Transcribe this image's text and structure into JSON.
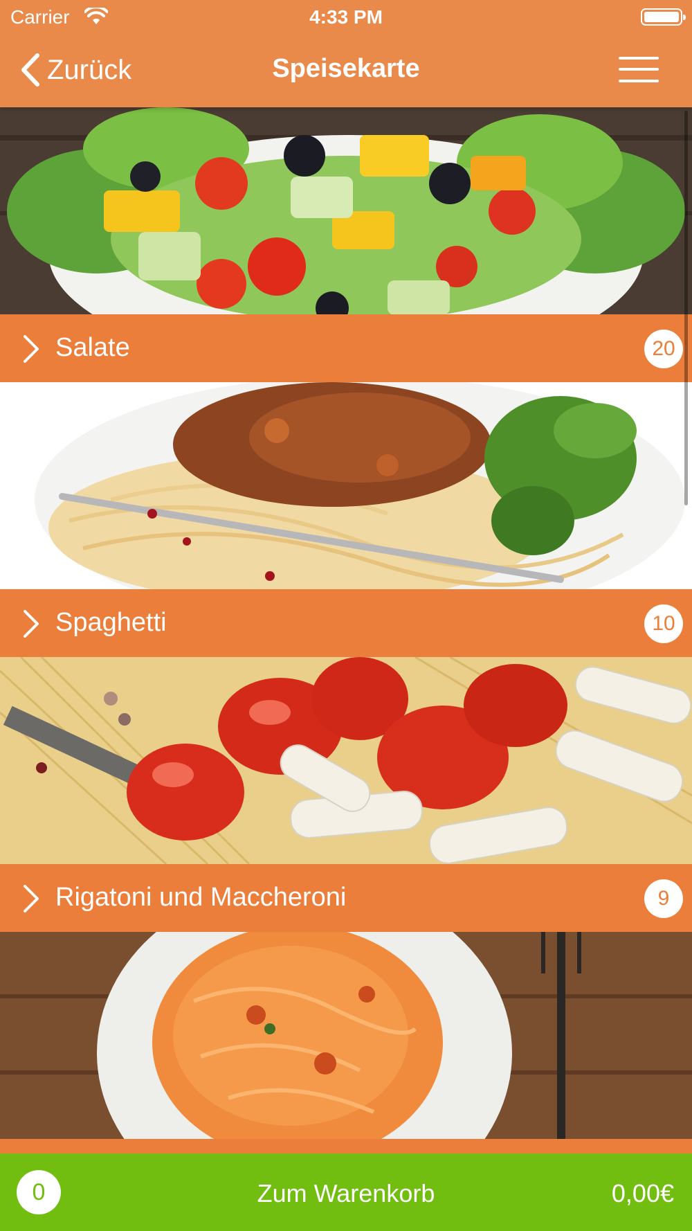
{
  "status_bar": {
    "carrier": "Carrier",
    "time": "4:33 PM"
  },
  "nav": {
    "back_label": "Zurück",
    "title": "Speisekarte",
    "icons": {
      "back": "chevron-left-icon",
      "menu": "hamburger-menu-icon"
    }
  },
  "categories": [
    {
      "name": "Salate",
      "count": "20",
      "image": "salad-photo"
    },
    {
      "name": "Spaghetti",
      "count": "10",
      "image": "spaghetti-bolognese-photo"
    },
    {
      "name": "Rigatoni und Maccheroni",
      "count": "9",
      "image": "rigatoni-tomatoes-photo"
    },
    {
      "name": "",
      "count": "",
      "image": "tagliatelle-photo"
    }
  ],
  "cart": {
    "count": "0",
    "label": "Zum Warenkorb",
    "total": "0,00€"
  },
  "colors": {
    "header": "#E9894A",
    "category_bar": "#EB7E3A",
    "cart_bar": "#71BE11",
    "text_on_color": "#FFFFFF"
  }
}
